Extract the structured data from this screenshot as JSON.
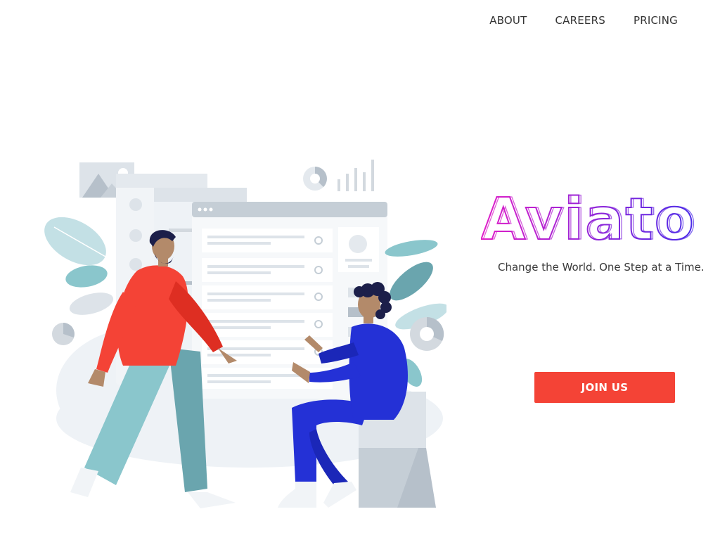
{
  "nav": {
    "items": [
      {
        "label": "ABOUT"
      },
      {
        "label": "CAREERS"
      },
      {
        "label": "PRICING"
      }
    ]
  },
  "hero": {
    "brand": "Aviato",
    "tagline": "Change the World. One Step at a Time.",
    "cta_label": "JOIN US"
  },
  "colors": {
    "brand_gradient_start": "#e01ec8",
    "brand_gradient_end": "#4a2be8",
    "cta": "#f44336",
    "person_shirt_red": "#f44336",
    "person_shirt_blue": "#2431d6",
    "pants_teal": "#8ac6cc"
  }
}
